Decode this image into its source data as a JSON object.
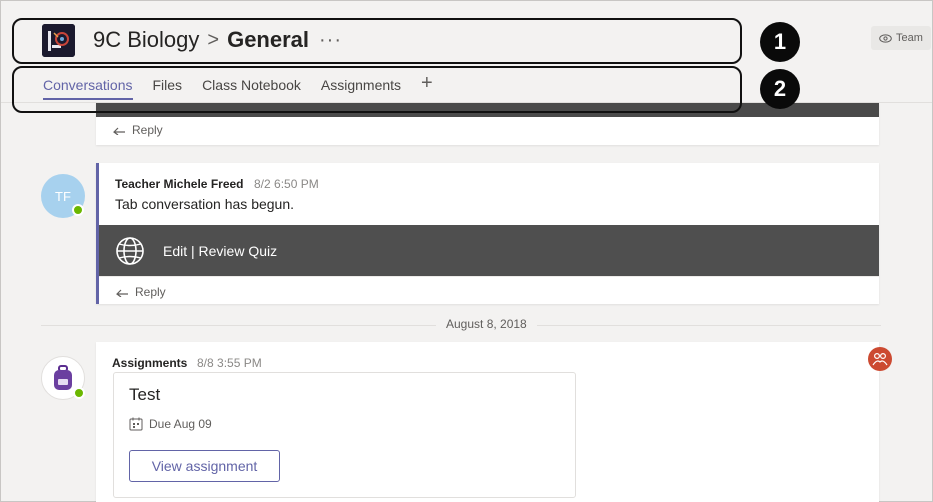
{
  "header": {
    "team_name": "9C Biology",
    "separator": ">",
    "channel_name": "General",
    "more": "···",
    "team_button_label": "Team"
  },
  "tabs": [
    {
      "label": "Conversations",
      "active": true
    },
    {
      "label": "Files",
      "active": false
    },
    {
      "label": "Class Notebook",
      "active": false
    },
    {
      "label": "Assignments",
      "active": false
    }
  ],
  "tab_add": "+",
  "callouts": [
    {
      "number": "1"
    },
    {
      "number": "2"
    }
  ],
  "reply_label": "Reply",
  "message": {
    "avatar_initials": "TF",
    "author": "Teacher Michele Freed",
    "time": "8/2 6:50 PM",
    "text": "Tab conversation has begun.",
    "tab_card_label": "Edit | Review Quiz"
  },
  "date_separator": "August 8, 2018",
  "assignment_post": {
    "author": "Assignments",
    "time": "8/8 3:55 PM",
    "card_title": "Test",
    "due": "Due Aug 09",
    "button_label": "View assignment"
  },
  "colors": {
    "accent": "#6264a7",
    "presence_available": "#6bb700",
    "reaction": "#cc4a31"
  }
}
